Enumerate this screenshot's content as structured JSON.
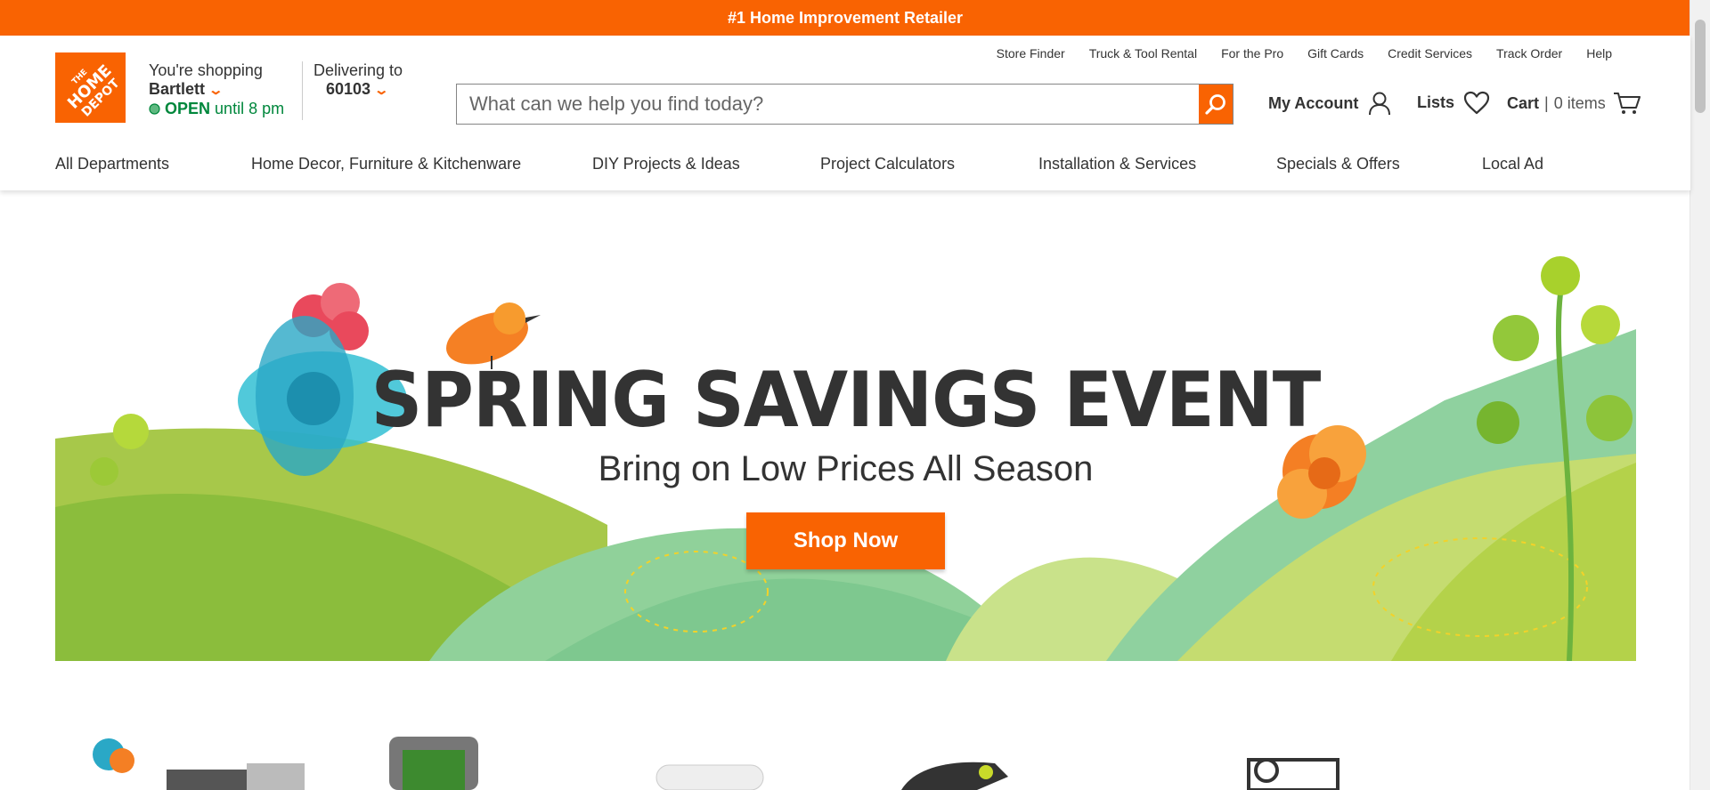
{
  "promo_bar": {
    "text": "#1 Home Improvement Retailer"
  },
  "logo": {
    "text": "THE HOME DEPOT"
  },
  "store": {
    "shopping_label": "You're shopping",
    "name": "Bartlett",
    "status": "OPEN",
    "hours": "until 8 pm"
  },
  "delivery": {
    "label": "Delivering to",
    "zip": "60103"
  },
  "utility_links": [
    "Store Finder",
    "Truck & Tool Rental",
    "For the Pro",
    "Gift Cards",
    "Credit Services",
    "Track Order",
    "Help"
  ],
  "search": {
    "placeholder": "What can we help you find today?"
  },
  "account": {
    "my_account": "My Account",
    "lists": "Lists",
    "cart_label": "Cart",
    "cart_separator": "|",
    "cart_count": "0 items"
  },
  "nav": [
    "All Departments",
    "Home Decor, Furniture & Kitchenware",
    "DIY Projects & Ideas",
    "Project Calculators",
    "Installation & Services",
    "Specials & Offers",
    "Local Ad"
  ],
  "hero": {
    "headline": "SPRING SAVINGS EVENT",
    "subheadline": "Bring on Low Prices All Season",
    "cta": "Shop Now"
  },
  "colors": {
    "brand_orange": "#f96302",
    "open_green": "#00873c",
    "text_dark": "#333333"
  },
  "icons": [
    "search-icon",
    "user-icon",
    "heart-icon",
    "cart-icon",
    "chevron-down-icon",
    "status-dot-icon"
  ]
}
